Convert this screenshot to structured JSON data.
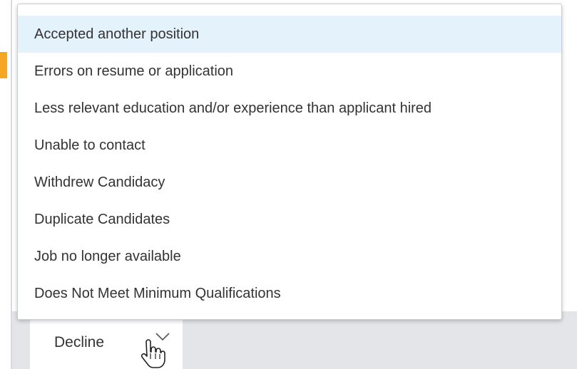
{
  "dropdown": {
    "options": [
      {
        "label": "Accepted another position",
        "highlighted": true
      },
      {
        "label": "Errors on resume or application",
        "highlighted": false
      },
      {
        "label": "Less relevant education and/or experience than applicant hired",
        "highlighted": false
      },
      {
        "label": "Unable to contact",
        "highlighted": false
      },
      {
        "label": "Withdrew Candidacy",
        "highlighted": false
      },
      {
        "label": "Duplicate Candidates",
        "highlighted": false
      },
      {
        "label": "Job no longer available",
        "highlighted": false
      },
      {
        "label": "Does Not Meet Minimum Qualifications",
        "highlighted": false
      }
    ]
  },
  "action": {
    "label": "Decline"
  },
  "icons": {
    "chevron": "chevron-down-icon",
    "cursor": "hand-pointer-cursor-icon"
  },
  "colors": {
    "highlight": "#e4f2fb",
    "accent": "#f5a623",
    "bar": "#e3e5e8",
    "text": "#333333"
  }
}
